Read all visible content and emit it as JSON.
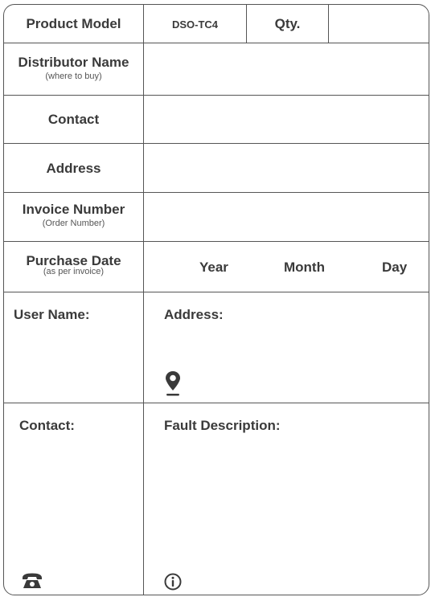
{
  "header": {
    "product_model_label": "Product Model",
    "product_model_value": "DSO-TC4",
    "qty_label": "Qty."
  },
  "rows": {
    "distributor_name": {
      "label": "Distributor Name",
      "hint": "(where to buy)"
    },
    "contact": {
      "label": "Contact"
    },
    "address": {
      "label": "Address"
    },
    "invoice_number": {
      "label": "Invoice Number",
      "hint": "(Order Number)"
    },
    "purchase_date": {
      "label": "Purchase Date",
      "hint": "(as per invoice)",
      "year": "Year",
      "month": "Month",
      "day": "Day"
    }
  },
  "user_section": {
    "user_name_label": "User Name:",
    "address_label": "Address:",
    "contact_label": "Contact:",
    "fault_label": "Fault Description:"
  },
  "icons": {
    "location": "location-pin-icon",
    "phone": "telephone-icon",
    "info": "info-icon"
  },
  "colors": {
    "line": "#555555",
    "text": "#3a3a3a"
  }
}
